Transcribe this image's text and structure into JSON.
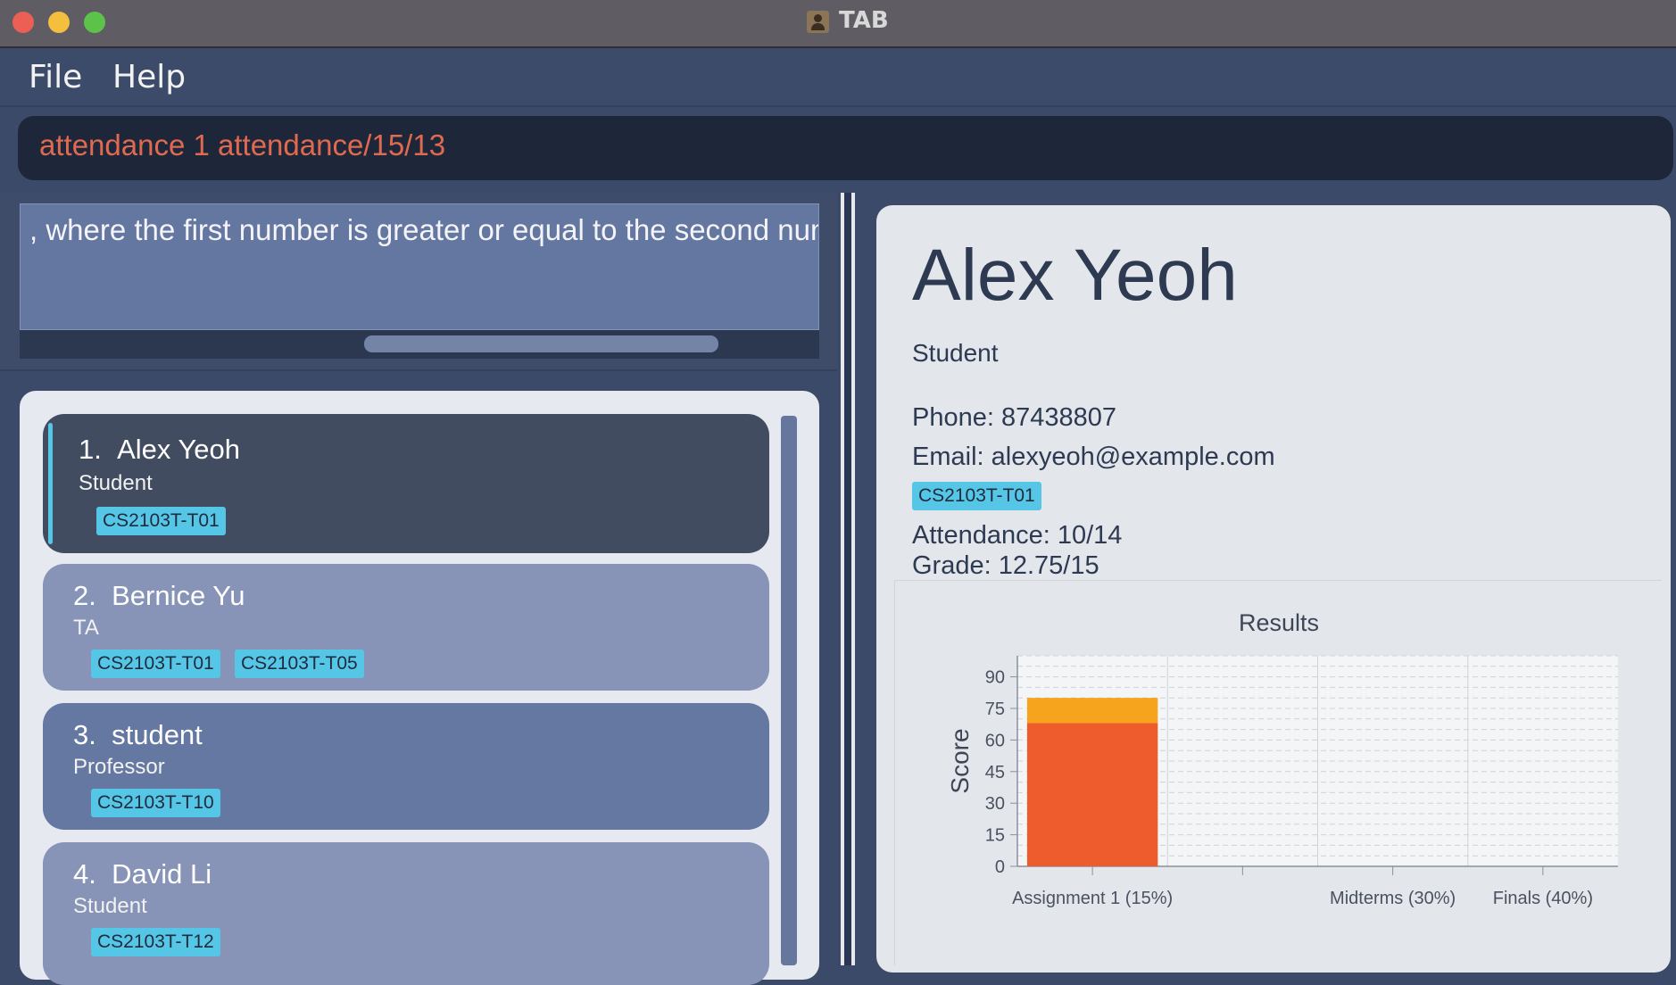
{
  "window": {
    "title": "TAB"
  },
  "menu": {
    "file": "File",
    "help": "Help"
  },
  "command": {
    "value": "attendance 1 attendance/15/13"
  },
  "result": {
    "text": ", where the first number is greater or equal to the second numb"
  },
  "persons": [
    {
      "index": "1.",
      "name": "Alex Yeoh",
      "role": "Student",
      "tags": [
        "CS2103T-T01"
      ]
    },
    {
      "index": "2.",
      "name": "Bernice Yu",
      "role": "TA",
      "tags": [
        "CS2103T-T01",
        "CS2103T-T05"
      ]
    },
    {
      "index": "3.",
      "name": "student",
      "role": "Professor",
      "tags": [
        "CS2103T-T10"
      ]
    },
    {
      "index": "4.",
      "name": "David Li",
      "role": "Student",
      "tags": [
        "CS2103T-T12"
      ]
    }
  ],
  "detail": {
    "name": "Alex Yeoh",
    "role": "Student",
    "phone": "Phone: 87438807",
    "email": "Email: alexyeoh@example.com",
    "tag": "CS2103T-T01",
    "attendance": "Attendance: 10/14",
    "grade": "Grade: 12.75/15"
  },
  "colors": {
    "selected_card": "#414c60",
    "card_light": "#8794b7",
    "card_dark": "#6578a2",
    "tag": "#56c6e6",
    "bar_score": "#ee5b2d",
    "bar_remainder": "#f6a31e",
    "selection_accent": "#56c6e6"
  },
  "icons": [
    "close-window-icon",
    "minimize-window-icon",
    "zoom-window-icon",
    "app-person-icon"
  ],
  "chart_data": {
    "type": "bar",
    "title": "Results",
    "ylabel": "Score",
    "xlabel": "",
    "categories": [
      "Assignment 1 (15%)",
      "",
      "Midterms (30%)",
      "Finals (40%)"
    ],
    "series": [
      {
        "values": [
          68,
          0,
          0,
          0
        ]
      },
      {
        "values": [
          12,
          0,
          0,
          0
        ]
      }
    ],
    "stacked": true,
    "yticks": [
      0,
      15,
      30,
      45,
      60,
      75,
      90
    ],
    "ylim": [
      0,
      100
    ],
    "grid": true
  }
}
